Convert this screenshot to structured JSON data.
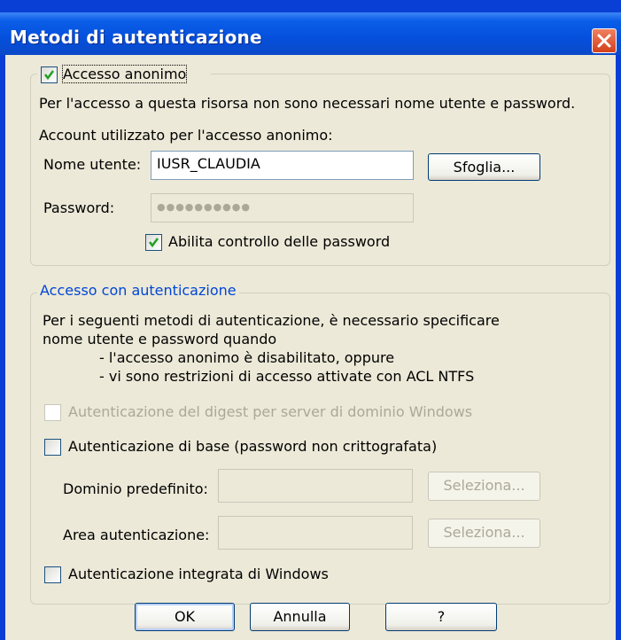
{
  "window": {
    "title": "Metodi di autenticazione"
  },
  "anonymous": {
    "checkbox_label": "Accesso anonimo",
    "checked": true,
    "description": "Per l'accesso a questa risorsa non sono necessari nome utente e password.",
    "account_heading": "Account utilizzato per l'accesso anonimo:",
    "username_label": "Nome utente:",
    "username_value": "IUSR_CLAUDIA",
    "browse_button": "Sfoglia...",
    "password_label": "Password:",
    "password_value": "●●●●●●●●●●",
    "password_control_label": "Abilita controllo delle password",
    "password_control_checked": true
  },
  "authenticated": {
    "group_label": "Accesso con autenticazione",
    "description_line1": "Per i seguenti metodi di autenticazione, è necessario specificare",
    "description_line2": "nome utente e password quando",
    "condition1": "- l'accesso anonimo è disabilitato, oppure",
    "condition2": "- vi sono restrizioni di accesso attivate con ACL NTFS",
    "digest_label": "Autenticazione del digest per server di dominio Windows",
    "basic_label": "Autenticazione di base (password non crittografata)",
    "default_domain_label": "Dominio predefinito:",
    "default_domain_value": "",
    "select_button_1": "Seleziona...",
    "realm_label": "Area autenticazione:",
    "realm_value": "",
    "select_button_2": "Seleziona...",
    "integrated_label": "Autenticazione integrata di Windows"
  },
  "buttons": {
    "ok": "OK",
    "cancel": "Annulla",
    "help": "?"
  },
  "colors": {
    "titlebar": "#0550dc",
    "client": "#ece9d8",
    "group_label_blue": "#0046d5",
    "disabled_text": "#aca899"
  }
}
